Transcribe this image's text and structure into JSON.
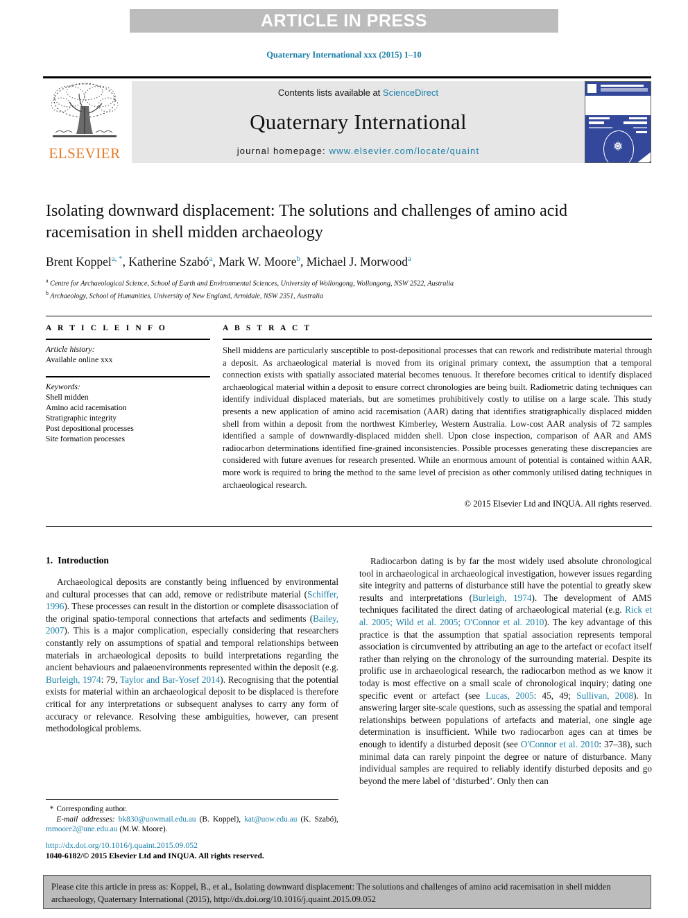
{
  "banner": {
    "text": "ARTICLE IN PRESS"
  },
  "journal_ref": "Quaternary International xxx (2015) 1–10",
  "masthead": {
    "publisher": "ELSEVIER",
    "contents_prefix": "Contents lists available at ",
    "sciencedirect": "ScienceDirect",
    "journal_title": "Quaternary International",
    "homepage_label": "journal homepage: ",
    "homepage_url": "www.elsevier.com/locate/quaint"
  },
  "article": {
    "title": "Isolating downward displacement: The solutions and challenges of amino acid racemisation in shell midden archaeology",
    "authors": [
      {
        "name": "Brent Koppel",
        "marks": "a, *"
      },
      {
        "name": "Katherine Szabó",
        "marks": "a"
      },
      {
        "name": "Mark W. Moore",
        "marks": "b"
      },
      {
        "name": "Michael J. Morwood",
        "marks": "a"
      }
    ],
    "affiliations": [
      {
        "mark": "a",
        "text": "Centre for Archaeological Science, School of Earth and Environmental Sciences, University of Wollongong, Wollongong, NSW 2522, Australia"
      },
      {
        "mark": "b",
        "text": "Archaeology, School of Humanities, University of New England, Armidale, NSW 2351, Australia"
      }
    ]
  },
  "article_info": {
    "heading": "A R T I C L E  I N F O",
    "history_label": "Article history:",
    "history_value": "Available online xxx",
    "keywords_label": "Keywords:",
    "keywords": [
      "Shell midden",
      "Amino acid racemisation",
      "Stratigraphic integrity",
      "Post depositional processes",
      "Site formation processes"
    ]
  },
  "abstract": {
    "heading": "A B S T R A C T",
    "text": "Shell middens are particularly susceptible to post-depositional processes that can rework and redistribute material through a deposit. As archaeological material is moved from its original primary context, the assumption that a temporal connection exists with spatially associated material becomes tenuous. It therefore becomes critical to identify displaced archaeological material within a deposit to ensure correct chronologies are being built. Radiometric dating techniques can identify individual displaced materials, but are sometimes prohibitively costly to utilise on a large scale. This study presents a new application of amino acid racemisation (AAR) dating that identifies stratigraphically displaced midden shell from within a deposit from the northwest Kimberley, Western Australia. Low-cost AAR analysis of 72 samples identified a sample of downwardly-displaced midden shell. Upon close inspection, comparison of AAR and AMS radiocarbon determinations identified fine-grained inconsistencies. Possible processes generating these discrepancies are considered with future avenues for research presented. While an enormous amount of potential is contained within AAR, more work is required to bring the method to the same level of precision as other commonly utilised dating techniques in archaeological research.",
    "copyright": "© 2015 Elsevier Ltd and INQUA. All rights reserved."
  },
  "body": {
    "section_number": "1.",
    "section_title": "Introduction",
    "left_paragraphs": [
      "Archaeological deposits are constantly being influenced by environmental and cultural processes that can add, remove or redistribute material (Schiffer, 1996). These processes can result in the distortion or complete disassociation of the original spatio-temporal connections that artefacts and sediments (Bailey, 2007). This is a major complication, especially considering that researchers constantly rely on assumptions of spatial and temporal relationships between materials in archaeological deposits to build interpretations regarding the ancient behaviours and palaeoenvironments represented within the deposit (e.g. Burleigh, 1974: 79, Taylor and Bar-Yosef 2014). Recognising that the potential exists for material within an archaeological deposit to be displaced is therefore critical for any interpretations or subsequent analyses to carry any form of accuracy or relevance. Resolving these ambiguities, however, can present methodological problems."
    ],
    "right_paragraphs": [
      "Radiocarbon dating is by far the most widely used absolute chronological tool in archaeological in archaeological investigation, however issues regarding site integrity and patterns of disturbance still have the potential to greatly skew results and interpretations (Burleigh, 1974). The development of AMS techniques facilitated the direct dating of archaeological material (e.g. Rick et al. 2005; Wild et al. 2005; O'Connor et al. 2010). The key advantage of this practice is that the assumption that spatial association represents temporal association is circumvented by attributing an age to the artefact or ecofact itself rather than relying on the chronology of the surrounding material. Despite its prolific use in archaeological research, the radiocarbon method as we know it today is most effective on a small scale of chronological inquiry; dating one specific event or artefact (see Lucas, 2005: 45, 49; Sullivan, 2008). In answering larger site-scale questions, such as assessing the spatial and temporal relationships between populations of artefacts and material, one single age determination is insufficient. While two radiocarbon ages can at times be enough to identify a disturbed deposit (see O'Connor et al. 2010: 37–38), such minimal data can rarely pinpoint the degree or nature of disturbance. Many individual samples are required to reliably identify disturbed deposits and go beyond the mere label of 'disturbed'. Only then can"
    ]
  },
  "footnote": {
    "corresponding_marker": "*",
    "corresponding_label": "Corresponding author.",
    "email_label": "E-mail addresses:",
    "emails": [
      {
        "address": "bk830@uowmail.edu.au",
        "owner": "(B. Koppel)"
      },
      {
        "address": "kat@uow.edu.au",
        "owner": "(K. Szabó)"
      },
      {
        "address": "mmoore2@une.edu.au",
        "owner": "(M.W. Moore)"
      }
    ]
  },
  "footer": {
    "doi": "http://dx.doi.org/10.1016/j.quaint.2015.09.052",
    "issn_line": "1040-6182/© 2015 Elsevier Ltd and INQUA. All rights reserved."
  },
  "cite_box": {
    "text": "Please cite this article in press as: Koppel, B., et al., Isolating downward displacement: The solutions and challenges of amino acid racemisation in shell midden archaeology, Quaternary International (2015), http://dx.doi.org/10.1016/j.quaint.2015.09.052"
  },
  "colors": {
    "link_blue": "#1a7fa8",
    "elsevier_orange": "#e87722",
    "banner_gray": "#bcbcbc",
    "masthead_gray": "#e6e6e6",
    "cover_blue": "#33489a"
  }
}
